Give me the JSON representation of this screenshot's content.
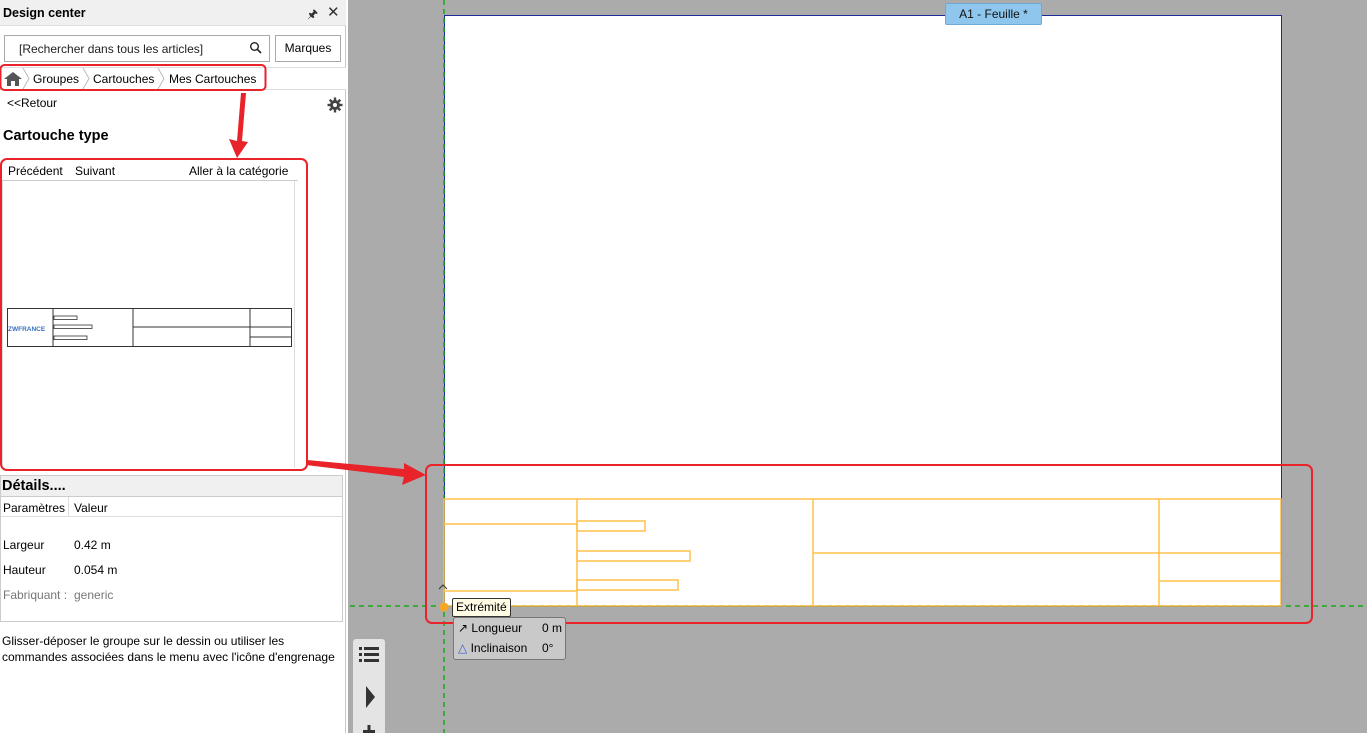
{
  "panel": {
    "title": "Design center",
    "search_placeholder": "[Rechercher dans tous les articles]",
    "brands_button": "Marques",
    "breadcrumb": [
      "Groupes",
      "Cartouches",
      "Mes Cartouches"
    ],
    "back_link": "<<Retour",
    "block_title": "Cartouche type",
    "preview_nav": {
      "previous": "Précédent",
      "next": "Suivant",
      "goto_category": "Aller à la catégorie"
    },
    "thumbnail_logo_text": "ZWFRANCE",
    "details": {
      "title": "Détails....",
      "col_param": "Paramètres",
      "col_value": "Valeur",
      "rows": [
        {
          "label": "Largeur",
          "value": "0.42 m"
        },
        {
          "label": "Hauteur",
          "value": "0.054 m"
        },
        {
          "label": "Fabriquant :",
          "value": "generic"
        }
      ]
    },
    "help_text": "Glisser-déposer le groupe sur le dessin ou utiliser les commandes associées dans le menu avec l'icône d'engrenage"
  },
  "canvas": {
    "sheet_tab": "A1 - Feuille *",
    "snap_tooltip": "Extrémité",
    "measure": [
      {
        "label": "Longueur",
        "value": "0 m"
      },
      {
        "label": "Inclinaison",
        "value": "0°"
      }
    ]
  },
  "colors": {
    "highlight": "#e8232a",
    "title_block": "#ffc04a",
    "sheet_border": "#1c2a9a",
    "snap_line": "#19a919",
    "tab": "#8fc6ee"
  }
}
